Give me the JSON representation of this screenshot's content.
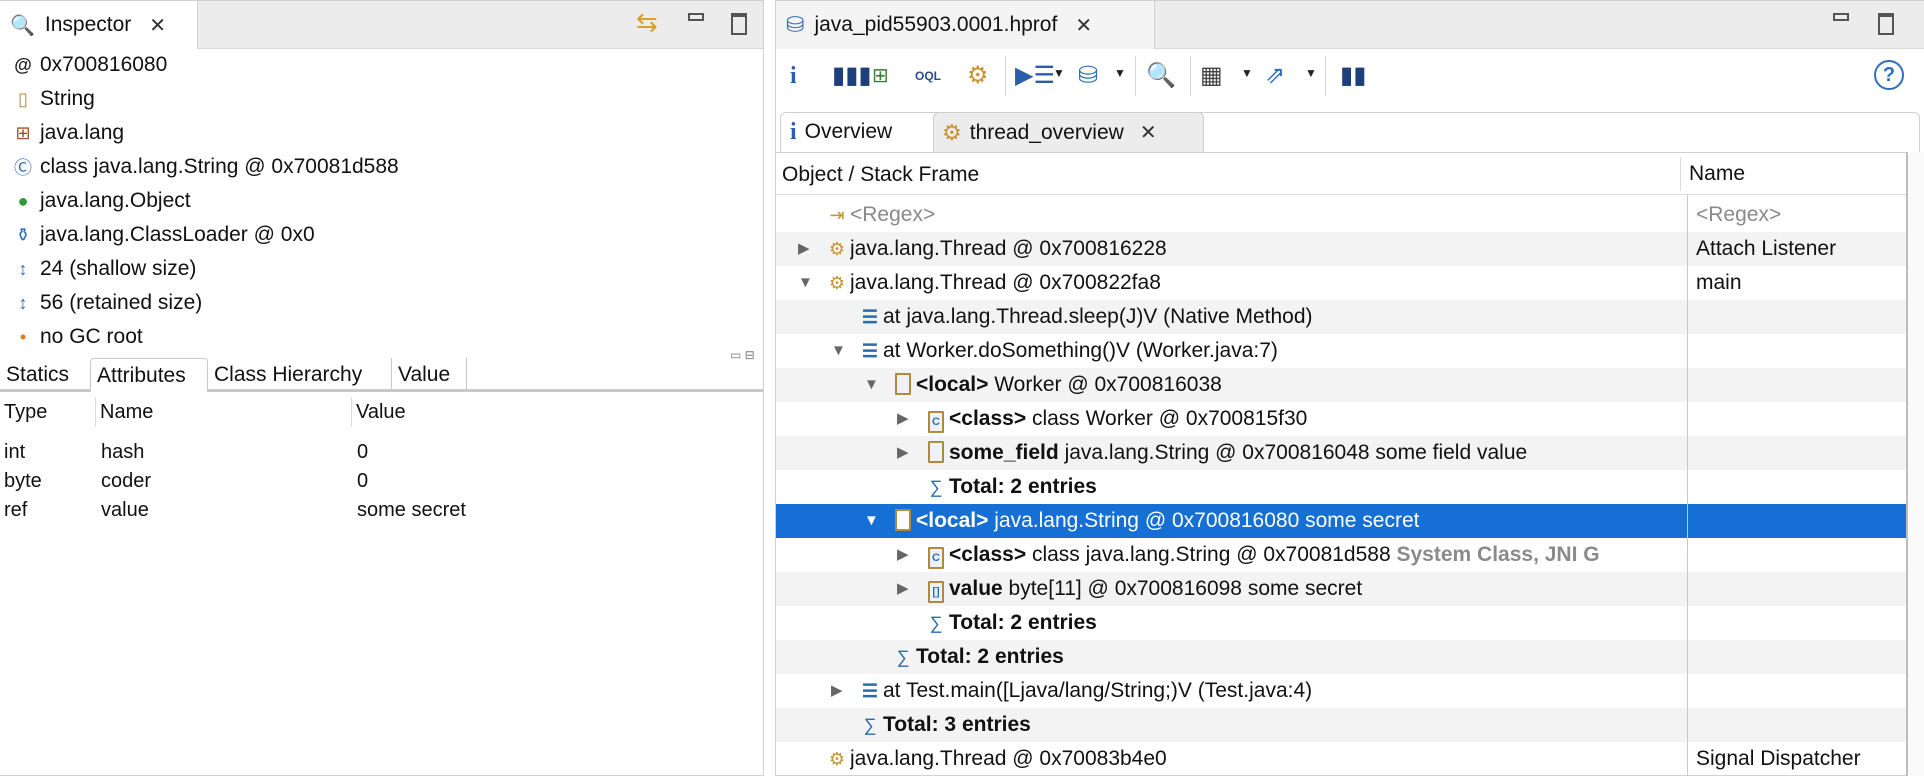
{
  "inspector": {
    "tab_label": "Inspector",
    "items": [
      {
        "icon": "at-icon",
        "text": "0x700816080"
      },
      {
        "icon": "file-icon",
        "text": "String"
      },
      {
        "icon": "package-icon",
        "text": "java.lang"
      },
      {
        "icon": "class-file-icon",
        "text": "class java.lang.String @ 0x70081d588"
      },
      {
        "icon": "superclass-icon",
        "text": "java.lang.Object"
      },
      {
        "icon": "classloader-icon",
        "text": "java.lang.ClassLoader @ 0x0"
      },
      {
        "icon": "shallow-size-icon",
        "text": "24 (shallow size)"
      },
      {
        "icon": "retained-size-icon",
        "text": "56 (retained size)"
      },
      {
        "icon": "gc-root-icon",
        "text": "no GC root"
      }
    ],
    "bottom_tabs": [
      "Statics",
      "Attributes",
      "Class Hierarchy",
      "Value"
    ],
    "active_bottom_tab": "Attributes",
    "table": {
      "columns": [
        "Type",
        "Name",
        "Value"
      ],
      "rows": [
        [
          "int",
          "hash",
          "0"
        ],
        [
          "byte",
          "coder",
          "0"
        ],
        [
          "ref",
          "value",
          "some secret"
        ]
      ]
    }
  },
  "editor": {
    "tab_label": "java_pid55903.0001.hprof",
    "inner_tabs": [
      "Overview",
      "thread_overview"
    ],
    "active_inner_tab": "thread_overview",
    "columns": [
      "Object / Stack Frame",
      "Name"
    ],
    "selection_color": "#156fd5",
    "rows": [
      {
        "level": 0,
        "expander": "",
        "icon": "regex",
        "bold": "",
        "text": "<Regex>",
        "grey": "",
        "name": "<Regex>",
        "regex": true
      },
      {
        "level": 0,
        "expander": "collapsed",
        "icon": "gear",
        "bold": "",
        "text": "java.lang.Thread @ 0x700816228",
        "grey": "",
        "name": "Attach Listener"
      },
      {
        "level": 0,
        "expander": "expanded",
        "icon": "gear",
        "bold": "",
        "text": "java.lang.Thread @ 0x700822fa8",
        "grey": "",
        "name": "main"
      },
      {
        "level": 1,
        "expander": "",
        "icon": "frame",
        "bold": "",
        "text": "at java.lang.Thread.sleep(J)V (Native Method)",
        "grey": "",
        "name": ""
      },
      {
        "level": 1,
        "expander": "expanded",
        "icon": "frame",
        "bold": "",
        "text": "at Worker.doSomething()V (Worker.java:7)",
        "grey": "",
        "name": ""
      },
      {
        "level": 2,
        "expander": "expanded",
        "icon": "doc",
        "bold": "<local>",
        "text": "Worker @ 0x700816038",
        "grey": "",
        "name": ""
      },
      {
        "level": 3,
        "expander": "collapsed",
        "icon": "class",
        "bold": "<class>",
        "text": "class Worker @ 0x700815f30",
        "grey": "",
        "name": ""
      },
      {
        "level": 3,
        "expander": "collapsed",
        "icon": "doc",
        "bold": "some_field",
        "text": "java.lang.String @ 0x700816048  some field value",
        "grey": "",
        "name": ""
      },
      {
        "level": 3,
        "expander": "",
        "icon": "sigma",
        "bold": "Total: 2 entries",
        "text": "",
        "grey": "",
        "name": ""
      },
      {
        "level": 2,
        "expander": "expanded",
        "icon": "doc",
        "bold": "<local>",
        "text": "java.lang.String @ 0x700816080  some secret",
        "grey": "",
        "name": "",
        "selected": true
      },
      {
        "level": 3,
        "expander": "collapsed",
        "icon": "class-root",
        "bold": "<class>",
        "text": "class java.lang.String @ 0x70081d588",
        "grey": "System Class, JNI G",
        "name": ""
      },
      {
        "level": 3,
        "expander": "collapsed",
        "icon": "array",
        "bold": "value",
        "text": "byte[11] @ 0x700816098  some secret",
        "grey": "",
        "name": ""
      },
      {
        "level": 3,
        "expander": "",
        "icon": "sigma",
        "bold": "Total: 2 entries",
        "text": "",
        "grey": "",
        "name": ""
      },
      {
        "level": 2,
        "expander": "",
        "icon": "sigma",
        "bold": "Total: 2 entries",
        "text": "",
        "grey": "",
        "name": ""
      },
      {
        "level": 1,
        "expander": "collapsed",
        "icon": "frame",
        "bold": "",
        "text": "at Test.main([Ljava/lang/String;)V (Test.java:4)",
        "grey": "",
        "name": ""
      },
      {
        "level": 1,
        "expander": "",
        "icon": "sigma",
        "bold": "Total: 3 entries",
        "text": "",
        "grey": "",
        "name": ""
      },
      {
        "level": 0,
        "expander": "",
        "icon": "gear",
        "bold": "",
        "text": "java.lang.Thread @ 0x70083b4e0",
        "grey": "",
        "name": "Signal Dispatcher"
      }
    ]
  }
}
